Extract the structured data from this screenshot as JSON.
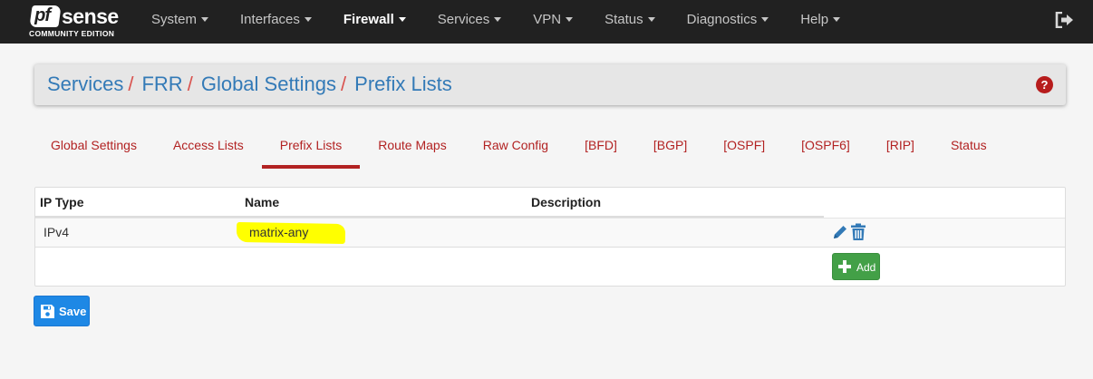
{
  "logo": {
    "brand_pf": "pf",
    "brand_sense": "sense",
    "edition": "COMMUNITY EDITION"
  },
  "nav": {
    "items": [
      {
        "label": "System",
        "active": false
      },
      {
        "label": "Interfaces",
        "active": false
      },
      {
        "label": "Firewall",
        "active": true
      },
      {
        "label": "Services",
        "active": false
      },
      {
        "label": "VPN",
        "active": false
      },
      {
        "label": "Status",
        "active": false
      },
      {
        "label": "Diagnostics",
        "active": false
      },
      {
        "label": "Help",
        "active": false
      }
    ],
    "logout_icon": "sign-out-icon"
  },
  "breadcrumb": {
    "items": [
      "Services",
      "FRR",
      "Global Settings",
      "Prefix Lists"
    ],
    "separator": "/",
    "help_label": "?"
  },
  "tabs": {
    "items": [
      "Global Settings",
      "Access Lists",
      "Prefix Lists",
      "Route Maps",
      "Raw Config",
      "[BFD]",
      "[BGP]",
      "[OSPF]",
      "[OSPF6]",
      "[RIP]",
      "Status"
    ],
    "active_index": 2
  },
  "table": {
    "headers": {
      "ip_type": "IP Type",
      "name": "Name",
      "description": "Description"
    },
    "rows": [
      {
        "ip_type": "IPv4",
        "name": "matrix-any",
        "description": ""
      }
    ],
    "add_label": "Add"
  },
  "save_label": "Save",
  "colors": {
    "link": "#337ab7",
    "tab": "#b22222",
    "navbar": "#212121",
    "add": "#43a047",
    "save": "#1e88e5",
    "highlight": "#ffff00"
  }
}
